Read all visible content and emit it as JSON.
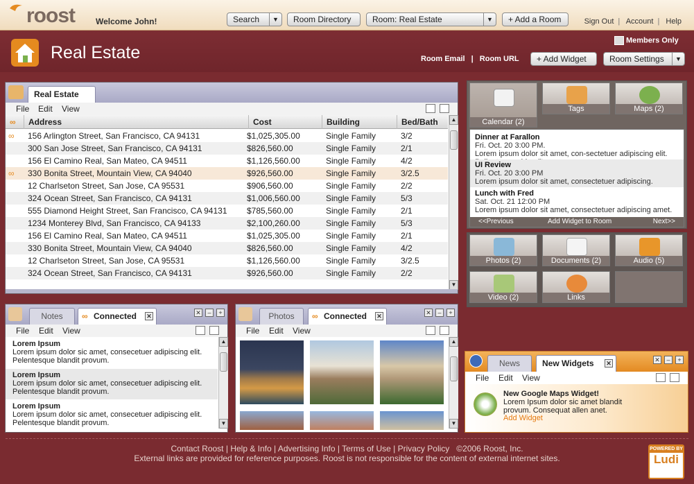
{
  "app": {
    "logo": "roost",
    "welcome": "Welcome John!"
  },
  "topnav": {
    "search_label": "Search",
    "room_directory": "Room Directory",
    "room_select": "Room: Real Estate",
    "add_room": "+ Add a Room",
    "links": [
      "Sign Out",
      "Account",
      "Help"
    ]
  },
  "room": {
    "title": "Real Estate",
    "email": "Room Email",
    "url": "Room URL",
    "add_widget": "+ Add Widget",
    "settings": "Room Settings",
    "members_only": "Members Only"
  },
  "grid": {
    "tab": "Real Estate",
    "menu": [
      "File",
      "Edit",
      "View"
    ],
    "columns": [
      "Address",
      "Cost",
      "Building",
      "Bed/Bath"
    ],
    "rows": [
      [
        "156 Arlington Street, San Francisco, CA 94131",
        "$1,025,305.00",
        "Single Family",
        "3/2"
      ],
      [
        "300 San Jose Street, San Francisco, CA 94131",
        "$826,560.00",
        "Single Family",
        "2/1"
      ],
      [
        "156 El Camino Real, San Mateo, CA 94511",
        "$1,126,560.00",
        "Single Family",
        "4/2"
      ],
      [
        "330 Bonita Street, Mountain View, CA 94040",
        "$926,560.00",
        "Single Family",
        "3/2.5"
      ],
      [
        "12 Charlseton Street, San Jose, CA 95531",
        "$906,560.00",
        "Single Family",
        "2/2"
      ],
      [
        "324 Ocean Street, San Francisco, CA 94131",
        "$1,006,560.00",
        "Single Family",
        "5/3"
      ],
      [
        "555 Diamond Height Street, San Francisco, CA 94131",
        "$785,560.00",
        "Single Family",
        "2/1"
      ],
      [
        "1234 Monterey Blvd, San Francisco, CA 94133",
        "$2,100,260.00",
        "Single Family",
        "5/3"
      ],
      [
        "156 El Camino Real, San Mateo, CA 94511",
        "$1,025,305.00",
        "Single Family",
        "2/1"
      ],
      [
        "330 Bonita Street, Mountain View, CA 94040",
        "$826,560.00",
        "Single Family",
        "4/2"
      ],
      [
        "12 Charlseton Street, San Jose, CA 95531",
        "$1,126,560.00",
        "Single Family",
        "3/2.5"
      ],
      [
        "324 Ocean Street, San Francisco, CA 94131",
        "$926,560.00",
        "Single Family",
        "2/2"
      ]
    ]
  },
  "notes": {
    "tab_notes": "Notes",
    "tab_connected": "Connected",
    "menu": [
      "File",
      "Edit",
      "View"
    ],
    "items": [
      {
        "title": "Lorem Ipsum",
        "text": "Lorem ipsum dolor sic amet, consecetuer adipiscing elit. Pelentesque blandit provum."
      },
      {
        "title": "Lorem Ipsum",
        "text": "Lorem ipsum dolor sic amet, consecetuer adipiscing elit. Pelentesque blandit provum."
      },
      {
        "title": "Lorem Ipsum",
        "text": "Lorem ipsum dolor sic amet, consecetuer adipiscing elit. Pelentesque blandit provum."
      }
    ]
  },
  "photos": {
    "tab_photos": "Photos",
    "tab_connected": "Connected",
    "menu": [
      "File",
      "Edit",
      "View"
    ]
  },
  "sidebar": {
    "tiles_top": [
      {
        "label": "Calendar (2)"
      },
      {
        "label": "Tags"
      },
      {
        "label": "Maps (2)"
      }
    ],
    "events": [
      {
        "title": "Dinner at Farallon",
        "when": "Fri. Oct. 20 3:00 PM.",
        "desc": "Lorem ipsum dolor sit amet, con-sectetuer adipiscing elit. Pellentesque blandit."
      },
      {
        "title": "UI Review",
        "when": "Fri. Oct. 20 3:00 PM",
        "desc": "Lorem ipsum dolor sit amet, consectetuer adipiscing."
      },
      {
        "title": "Lunch with Fred",
        "when": "Sat. Oct. 21 12:00 PM",
        "desc": "Lorem ipsum dolor sit amet, consectetuer adipiscing amet."
      }
    ],
    "cal_prev": "<<Previous",
    "cal_add": "Add Widget to Room",
    "cal_next": "Next>>",
    "tiles_mid": [
      {
        "label": "Photos (2)"
      },
      {
        "label": "Documents (2)"
      },
      {
        "label": "Audio (5)"
      },
      {
        "label": "Video (2)"
      },
      {
        "label": "Links"
      }
    ]
  },
  "news": {
    "tab_news": "News",
    "tab_widgets": "New Widgets",
    "menu": [
      "File",
      "Edit",
      "View"
    ],
    "headline": "New Google Maps Widget!",
    "body": "Lorem Ipsum dolor sic amet blandit provum. Consequat allen anet.",
    "link": "Add Widget"
  },
  "footer": {
    "links": [
      "Contact Roost",
      "Help & Info",
      "Advertising Info",
      "Terms of Use",
      "Privacy Policy"
    ],
    "copyright": "©2006 Roost, Inc.",
    "disclaimer": "External links are provided for reference purposes. Roost is not responsible for the content of external internet sites.",
    "powered": "POWERED BY",
    "brand": "Ludi"
  },
  "colors": {
    "maroon": "#7a2b30",
    "accent": "#e58a1f",
    "tab_blue": "#a9a9c6"
  }
}
